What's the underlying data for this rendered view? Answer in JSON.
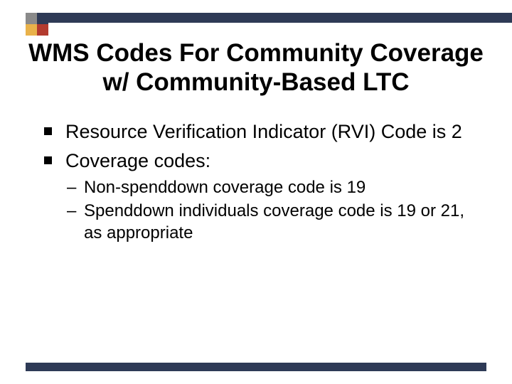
{
  "title": "WMS Codes For Community Coverage w/ Community-Based LTC",
  "bullets": [
    {
      "text": "Resource Verification Indicator (RVI) Code is 2"
    },
    {
      "text": "Coverage codes:"
    }
  ],
  "subbullets": [
    {
      "text": "Non-spenddown coverage code is 19"
    },
    {
      "text": "Spenddown individuals coverage code is 19 or 21, as appropriate"
    }
  ],
  "colors": {
    "bar": "#2e3a56",
    "logo_gray": "#8a8a8a",
    "logo_navy": "#2e3a56",
    "logo_gold": "#e9b24a",
    "logo_red": "#b33b2f"
  }
}
